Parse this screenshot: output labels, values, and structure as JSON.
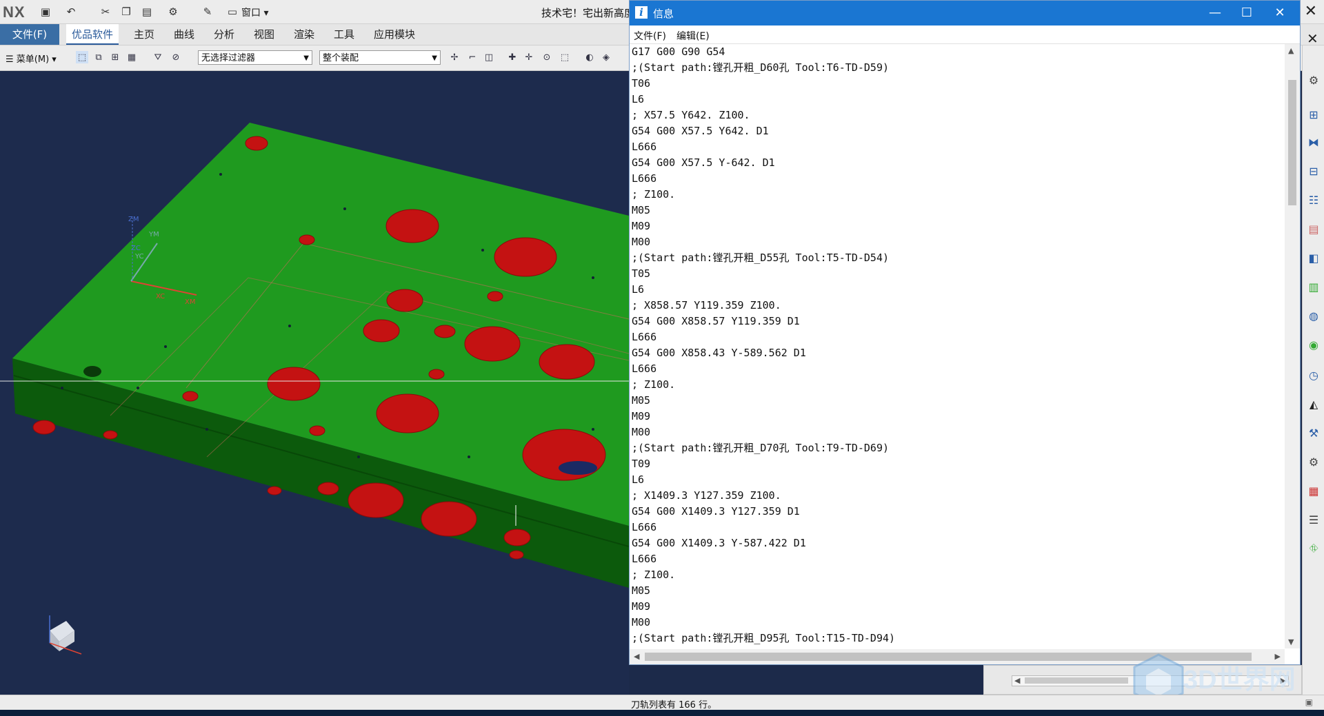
{
  "nx": {
    "logo": "NX",
    "window_menu_label": "窗口",
    "title_text": "技术宅！宅出新高度"
  },
  "ribbon": {
    "tabs": [
      "文件(F)",
      "优品软件",
      "主页",
      "曲线",
      "分析",
      "视图",
      "渲染",
      "工具",
      "应用模块"
    ]
  },
  "toolbar": {
    "menu_label": "菜单(M)",
    "filter_combo": "无选择过滤器",
    "scope_combo": "整个装配"
  },
  "viewport": {
    "triad_labels": [
      "ZM",
      "YM",
      "ZC",
      "YC",
      "XC",
      "XM"
    ]
  },
  "info_window": {
    "title": "信息",
    "menu": [
      "文件(F)",
      "编辑(E)"
    ],
    "lines": [
      "G17 G00 G90 G54",
      ";(Start path:镗孔开粗_D60孔 Tool:T6-TD-D59)",
      "T06",
      "L6",
      "; X57.5 Y642. Z100.",
      "G54 G00 X57.5 Y642. D1",
      "L666",
      "G54 G00 X57.5 Y-642. D1",
      "L666",
      "; Z100.",
      "M05",
      "M09",
      "M00",
      ";(Start path:镗孔开粗_D55孔 Tool:T5-TD-D54)",
      "T05",
      "L6",
      "; X858.57 Y119.359 Z100.",
      "G54 G00 X858.57 Y119.359 D1",
      "L666",
      "G54 G00 X858.43 Y-589.562 D1",
      "L666",
      "; Z100.",
      "M05",
      "M09",
      "M00",
      ";(Start path:镗孔开粗_D70孔 Tool:T9-TD-D69)",
      "T09",
      "L6",
      "; X1409.3 Y127.359 Z100.",
      "G54 G00 X1409.3 Y127.359 D1",
      "L666",
      "G54 G00 X1409.3 Y-587.422 D1",
      "L666",
      "; Z100.",
      "M05",
      "M09",
      "M00",
      ";(Start path:镗孔开粗_D95孔 Tool:T15-TD-D94)"
    ]
  },
  "status": {
    "text": "刀轨列表有 166 行。"
  },
  "watermark": {
    "text": "3D世界网"
  },
  "colors": {
    "plate": "#1f9a1f",
    "hole": "#c41212",
    "titlebar": "#1a76d2",
    "file_tab": "#3a6ea5"
  }
}
